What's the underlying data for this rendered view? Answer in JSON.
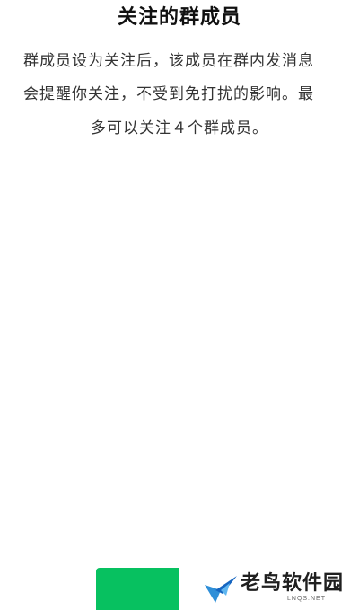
{
  "dialog": {
    "title": "关注的群成员",
    "description_lines": [
      "群成员设为关注后，该成员在群内发消息",
      "会提醒你关注，不受到免打扰的影响。最",
      "多可以关注４个群成员。"
    ]
  },
  "colors": {
    "primary_button": "#07c160",
    "title_text": "#111111",
    "body_text": "#333333"
  },
  "watermark": {
    "brand": "老鸟软件园",
    "domain": "LNQS.NET",
    "logo_icon": "bird-logo-icon"
  }
}
